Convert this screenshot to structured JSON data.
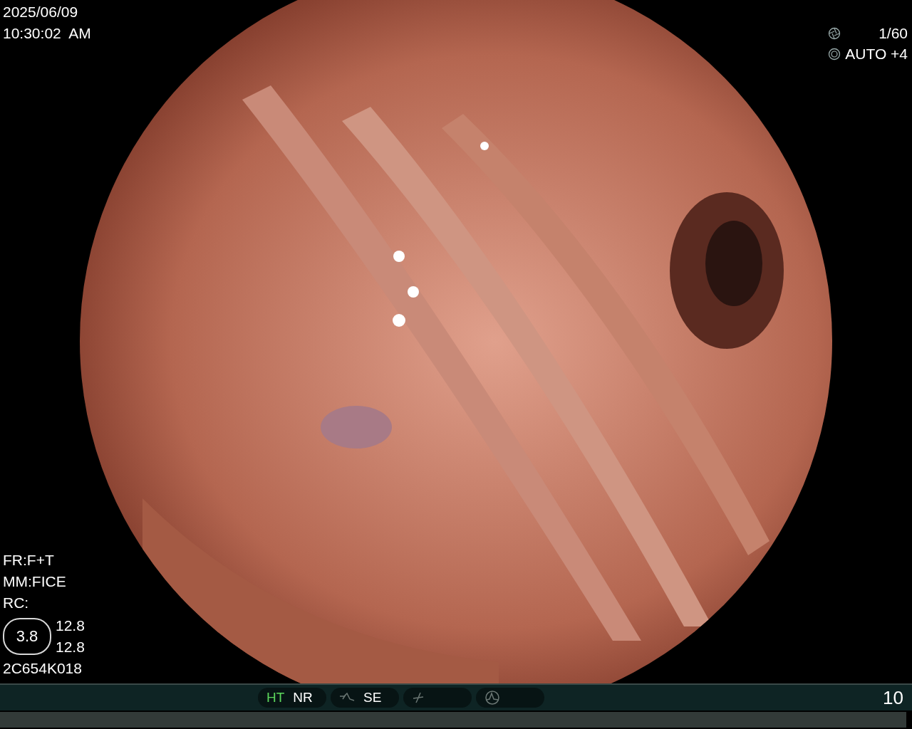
{
  "timestamp": {
    "date": "2025/06/09",
    "time": "10:30:02  AM"
  },
  "exposure": {
    "shutter": "1/60",
    "iris": "AUTO +4"
  },
  "settings": [
    {
      "text": "FR:F+T"
    },
    {
      "text": "MM:FICE"
    },
    {
      "text": "RC:"
    }
  ],
  "gauge": {
    "value": "3.8",
    "readings": [
      "12.8",
      "12.8"
    ]
  },
  "scope_id": "2C654K018",
  "status_bar": {
    "groups": [
      {
        "kind": "text",
        "items": [
          {
            "label": "HT",
            "on": true
          },
          {
            "label": "NR",
            "on": false
          }
        ]
      },
      {
        "kind": "curve",
        "items": [
          {
            "label": "SE",
            "on": false
          }
        ]
      },
      {
        "kind": "ramp"
      },
      {
        "kind": "peak"
      }
    ],
    "counter": "10"
  }
}
